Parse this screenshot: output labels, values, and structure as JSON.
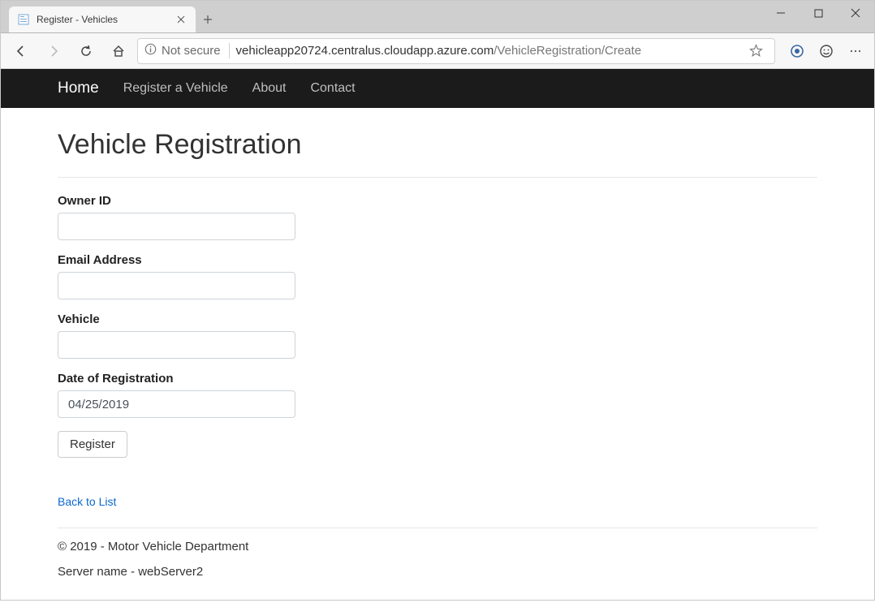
{
  "browser": {
    "tab_title": "Register - Vehicles",
    "url_badge_label": "Not secure",
    "url_host": "vehicleapp20724.centralus.cloudapp.azure.com",
    "url_path": "/VehicleRegistration/Create"
  },
  "nav": {
    "brand": "Home",
    "register": "Register a Vehicle",
    "about": "About",
    "contact": "Contact"
  },
  "page": {
    "title": "Vehicle Registration"
  },
  "form": {
    "owner_id_label": "Owner ID",
    "owner_id_value": "",
    "email_label": "Email Address",
    "email_value": "",
    "vehicle_label": "Vehicle",
    "vehicle_value": "",
    "date_label": "Date of Registration",
    "date_value": "04/25/2019",
    "submit_label": "Register",
    "back_label": "Back to List"
  },
  "footer": {
    "copyright": "© 2019 - Motor Vehicle Department",
    "server": "Server name - webServer2"
  }
}
